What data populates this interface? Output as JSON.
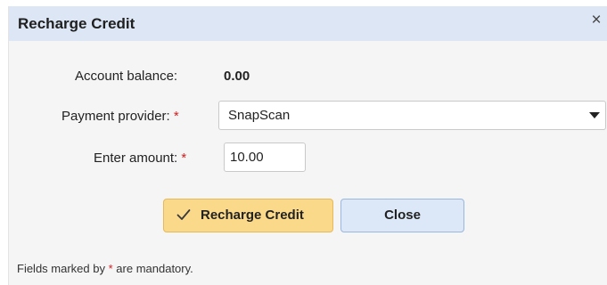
{
  "dialog": {
    "title": "Recharge Credit",
    "close_glyph": "×"
  },
  "form": {
    "balance_label": "Account balance:",
    "balance_value": "0.00",
    "provider_label": "Payment provider:",
    "provider_value": "SnapScan",
    "amount_label": "Enter amount:",
    "amount_value": "10.00",
    "required_marker": "*"
  },
  "buttons": {
    "recharge_label": "Recharge Credit",
    "close_label": "Close"
  },
  "footer": {
    "note_prefix": "Fields marked by",
    "note_marker": "*",
    "note_suffix": "are mandatory."
  },
  "colors": {
    "titlebar": "#dce6f4",
    "primary_button": "#fad98a",
    "secondary_button": "#dce8f8",
    "required": "#d02020"
  },
  "icons": {
    "close": "close-icon",
    "recharge": "check-icon",
    "dropdown": "caret-down-icon"
  }
}
